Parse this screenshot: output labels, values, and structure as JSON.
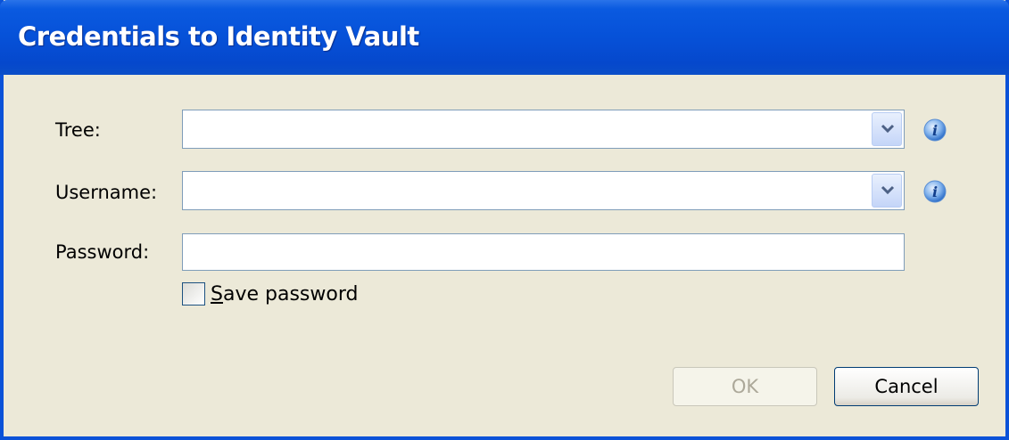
{
  "window": {
    "title": "Credentials to Identity Vault"
  },
  "form": {
    "tree_label": "Tree:",
    "tree_value": "",
    "username_label": "Username:",
    "username_value": "",
    "password_label": "Password:",
    "password_value": "",
    "save_password_label": "ave password",
    "save_password_accel": "S",
    "save_password_checked": false
  },
  "buttons": {
    "ok_label": "OK",
    "ok_enabled": false,
    "cancel_label": "Cancel"
  },
  "icons": {
    "info": "info-icon",
    "dropdown": "chevron-down-icon"
  },
  "colors": {
    "titlebar": "#0651d8",
    "dialog_bg": "#ece9d8",
    "input_border": "#7f9db9",
    "info_blue": "#3a80d0"
  }
}
